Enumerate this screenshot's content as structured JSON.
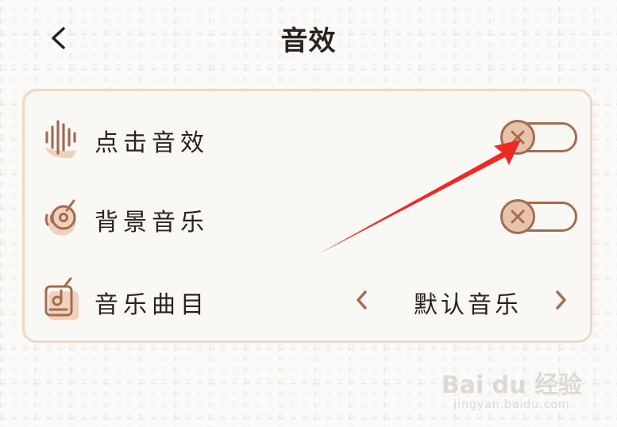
{
  "header": {
    "title": "音效"
  },
  "settings": {
    "click_sound": {
      "label": "点击音效",
      "state": "off"
    },
    "background_music": {
      "label": "背景音乐",
      "state": "off"
    },
    "music_track": {
      "label": "音乐曲目",
      "value": "默认音乐"
    }
  },
  "colors": {
    "accent": "#a36c50",
    "knob_fill": "#e8c3ab",
    "card_border": "#f0d7c0",
    "annotation_arrow": "#ee2a24"
  },
  "watermark": {
    "main": "Bai du 经验",
    "sub": "jingyan.baidu.com"
  },
  "icons": {
    "back": "chevron-left-icon",
    "click_sound": "sound-wave-icon",
    "background_music": "vinyl-disc-icon",
    "music_track": "music-player-icon",
    "toggle_off": "x-icon",
    "prev": "chevron-left-icon",
    "next": "chevron-right-icon"
  }
}
